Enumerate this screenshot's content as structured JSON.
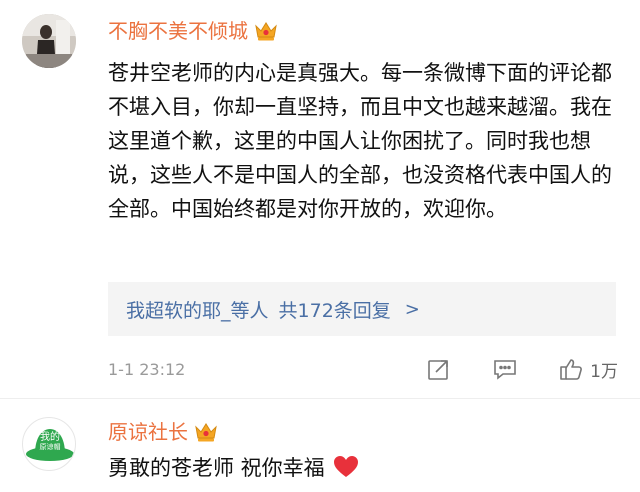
{
  "comments": [
    {
      "username": "不胸不美不倾城",
      "text": "苍井空老师的内心是真强大。每一条微博下面的评论都不堪入目，你却一直坚持，而且中文也越来越溜。我在这里道个歉，这里的中国人让你困扰了。同时我也想说，这些人不是中国人的全部，也没资格代表中国人的全部。中国始终都是对你开放的，欢迎你。",
      "replies": {
        "author_text": "我超软的耶_等人",
        "count_text": "共172条回复",
        "chevron": ">"
      },
      "timestamp": "1-1 23:12",
      "like_count": "1万",
      "icons": [
        "vip-crown-icon",
        "forward-icon",
        "comment-icon",
        "thumbs-up-icon"
      ]
    },
    {
      "username": "原谅社长",
      "avatar_text_1": "我的",
      "avatar_text_2": "原谅帽",
      "text": "勇敢的苍老师 祝你幸福",
      "icons": [
        "vip-crown-icon",
        "heart-icon"
      ]
    }
  ],
  "colors": {
    "username": "#eb7340",
    "link": "#4a6fa5",
    "crown_gold": "#f5a623",
    "heart_red": "#e8313b",
    "avatar_green": "#2fa84f"
  }
}
